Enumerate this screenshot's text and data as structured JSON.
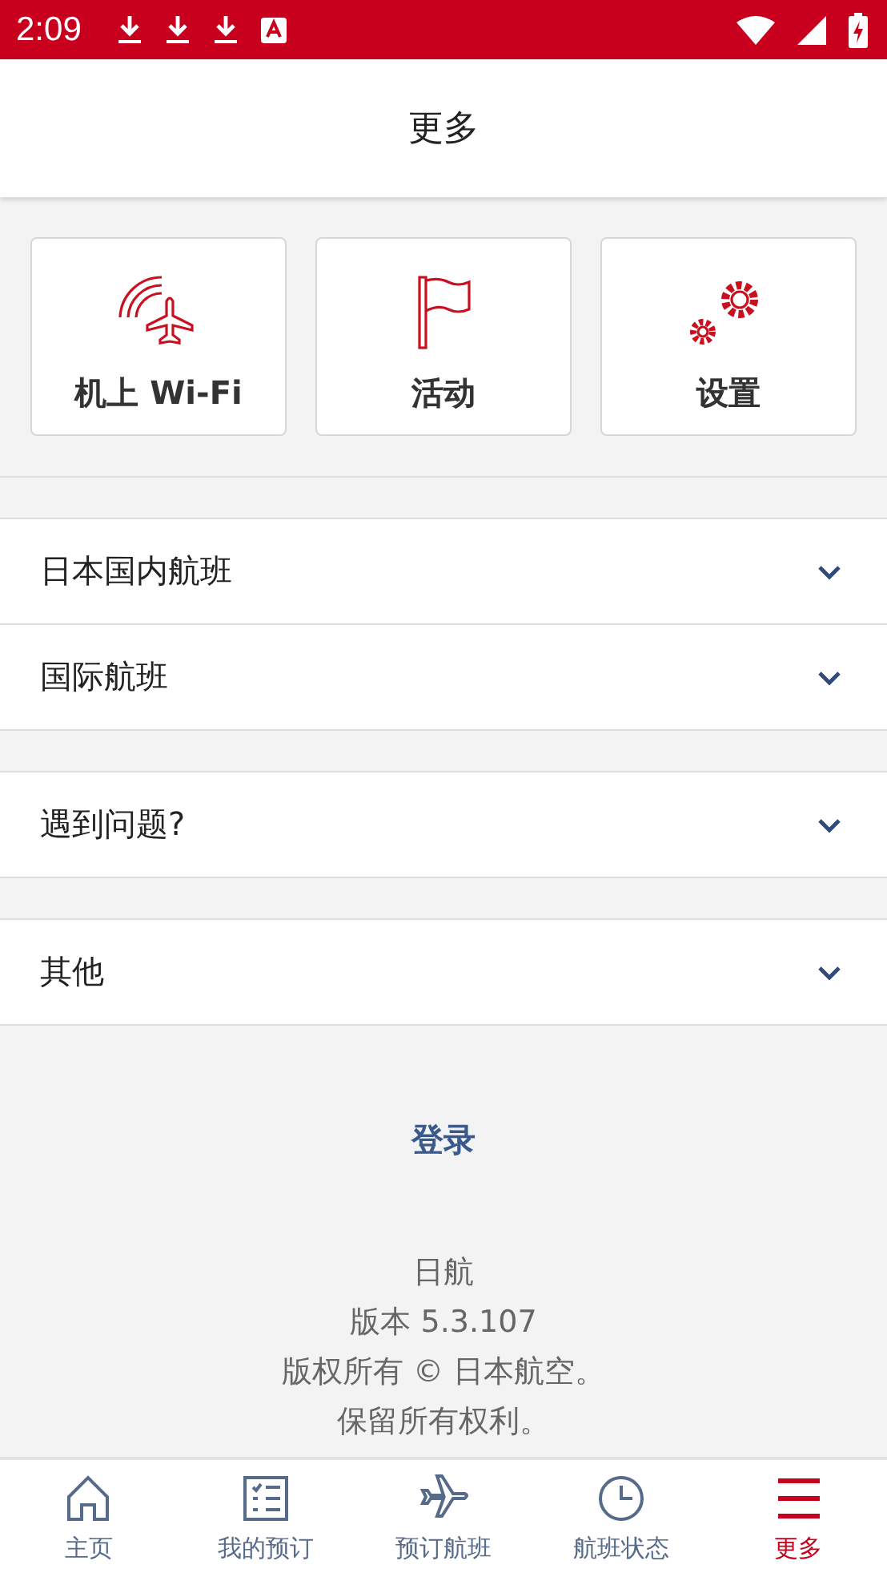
{
  "status_bar": {
    "time": "2:09"
  },
  "header": {
    "title": "更多"
  },
  "shortcuts": [
    {
      "kind": "wifi",
      "label": "机上 Wi-Fi"
    },
    {
      "kind": "flag",
      "label": "活动"
    },
    {
      "kind": "settings",
      "label": "设置"
    }
  ],
  "section_groups": [
    [
      {
        "label": "日本国内航班",
        "expanded": false
      },
      {
        "label": "国际航班",
        "expanded": false
      }
    ],
    [
      {
        "label": "遇到问题?",
        "expanded": false
      }
    ],
    [
      {
        "label": "其他",
        "expanded": false
      }
    ]
  ],
  "login_link": "登录",
  "footer": [
    "日航",
    "版本 5.3.107",
    "版权所有 © 日本航空。",
    "保留所有权利。"
  ],
  "nav": [
    {
      "kind": "home",
      "label": "主页",
      "selected": false
    },
    {
      "kind": "list",
      "label": "我的预订",
      "selected": false
    },
    {
      "kind": "plane",
      "label": "预订航班",
      "selected": false
    },
    {
      "kind": "clock",
      "label": "航班状态",
      "selected": false
    },
    {
      "kind": "menu",
      "label": "更多",
      "selected": true
    }
  ]
}
